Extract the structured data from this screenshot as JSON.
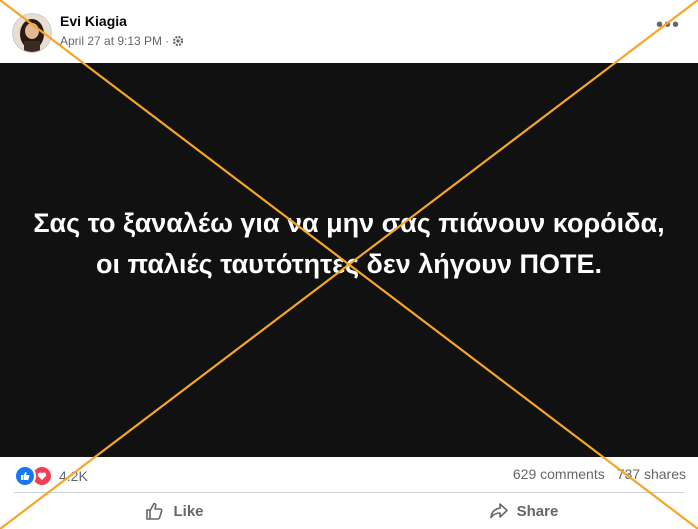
{
  "post": {
    "author": "Evi Kiagia",
    "timestamp": "April 27 at 9:13 PM",
    "separator": "·",
    "privacy_icon": "gear-icon",
    "more_icon": "more-options-icon",
    "more_label": "•••"
  },
  "media": {
    "text": "Σας το ξαναλέω για να μην σας πιάνουν κορόιδα, οι παλιές ταυτότητες δεν λήγουν ΠΟΤΕ.",
    "background": "#111111",
    "text_color": "#ffffff"
  },
  "stats": {
    "reaction_icons": [
      "like-reaction-icon",
      "love-reaction-icon"
    ],
    "reactions": "4.2K",
    "comments": "629 comments",
    "shares": "737 shares"
  },
  "actions": {
    "like_label": "Like",
    "share_label": "Share"
  },
  "colors": {
    "cross_overlay": "#f5a623",
    "like_blue": "#1877f2",
    "love_red": "#f33e58",
    "secondary_text": "#65676b"
  }
}
